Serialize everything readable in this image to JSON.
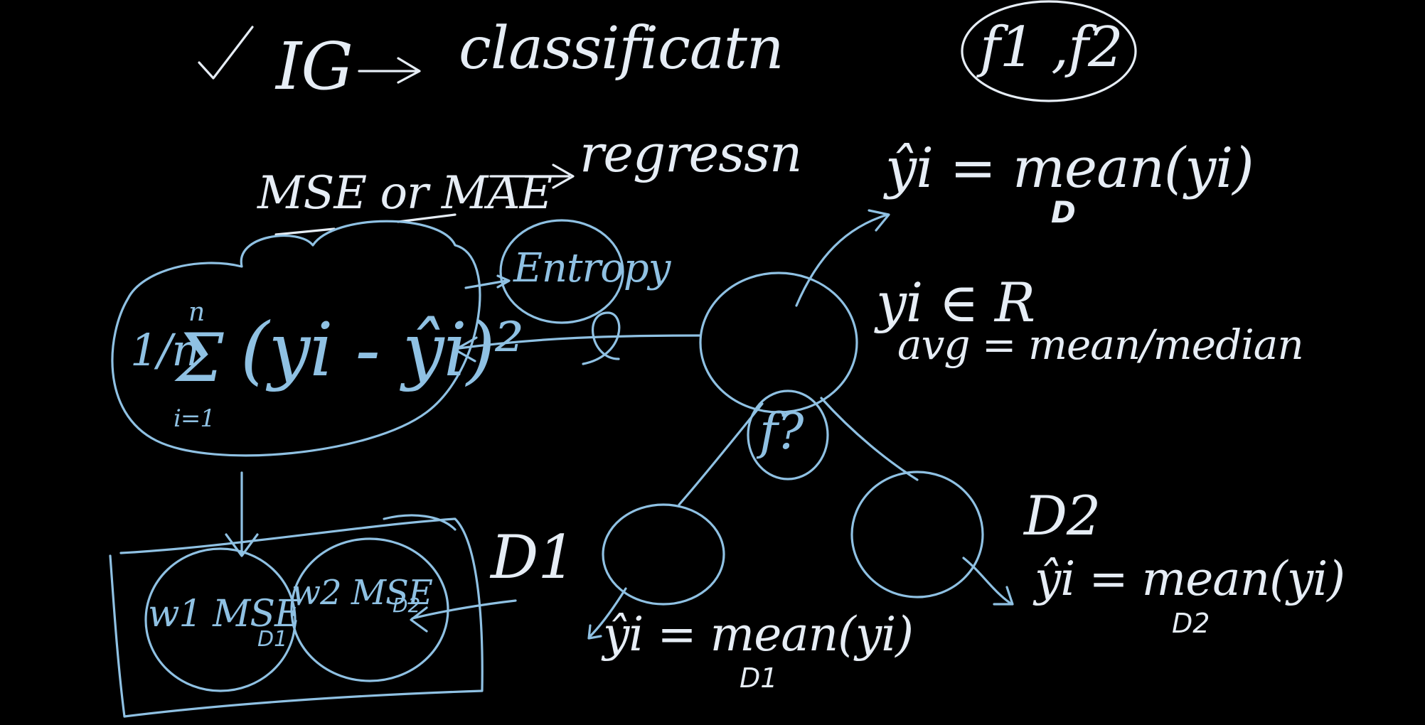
{
  "colors": {
    "background": "#000000",
    "white_ink": "#e6edf5",
    "blue_ink": "#8fc1e3"
  },
  "notes": {
    "ig": "IG",
    "classification": "classificatn",
    "features": "f1 ,f2",
    "mse_or_mae": "MSE or MAE",
    "regression": "regressn",
    "entropy": "Entropy",
    "formula_frac": "1/n",
    "formula_sum_top": "n",
    "formula_sum_bottom": "i=1",
    "formula_body": "(yi - ŷi)²",
    "node_split_label": "f?",
    "root_prediction": "ŷi = mean(yi)",
    "root_prediction_sub": "D",
    "target_domain": "yi ∈ R",
    "avg_rule": "avg = mean/median",
    "d1_label": "D1",
    "d2_label": "D2",
    "left_prediction": "ŷi = mean(yi)",
    "left_prediction_sub": "D1",
    "right_prediction": "ŷi = mean(yi)",
    "right_prediction_sub": "D2",
    "weighted_left": "w1 MSE",
    "weighted_left_sub": "D1",
    "weighted_right": "w2 MSE",
    "weighted_right_sub": "D2"
  }
}
